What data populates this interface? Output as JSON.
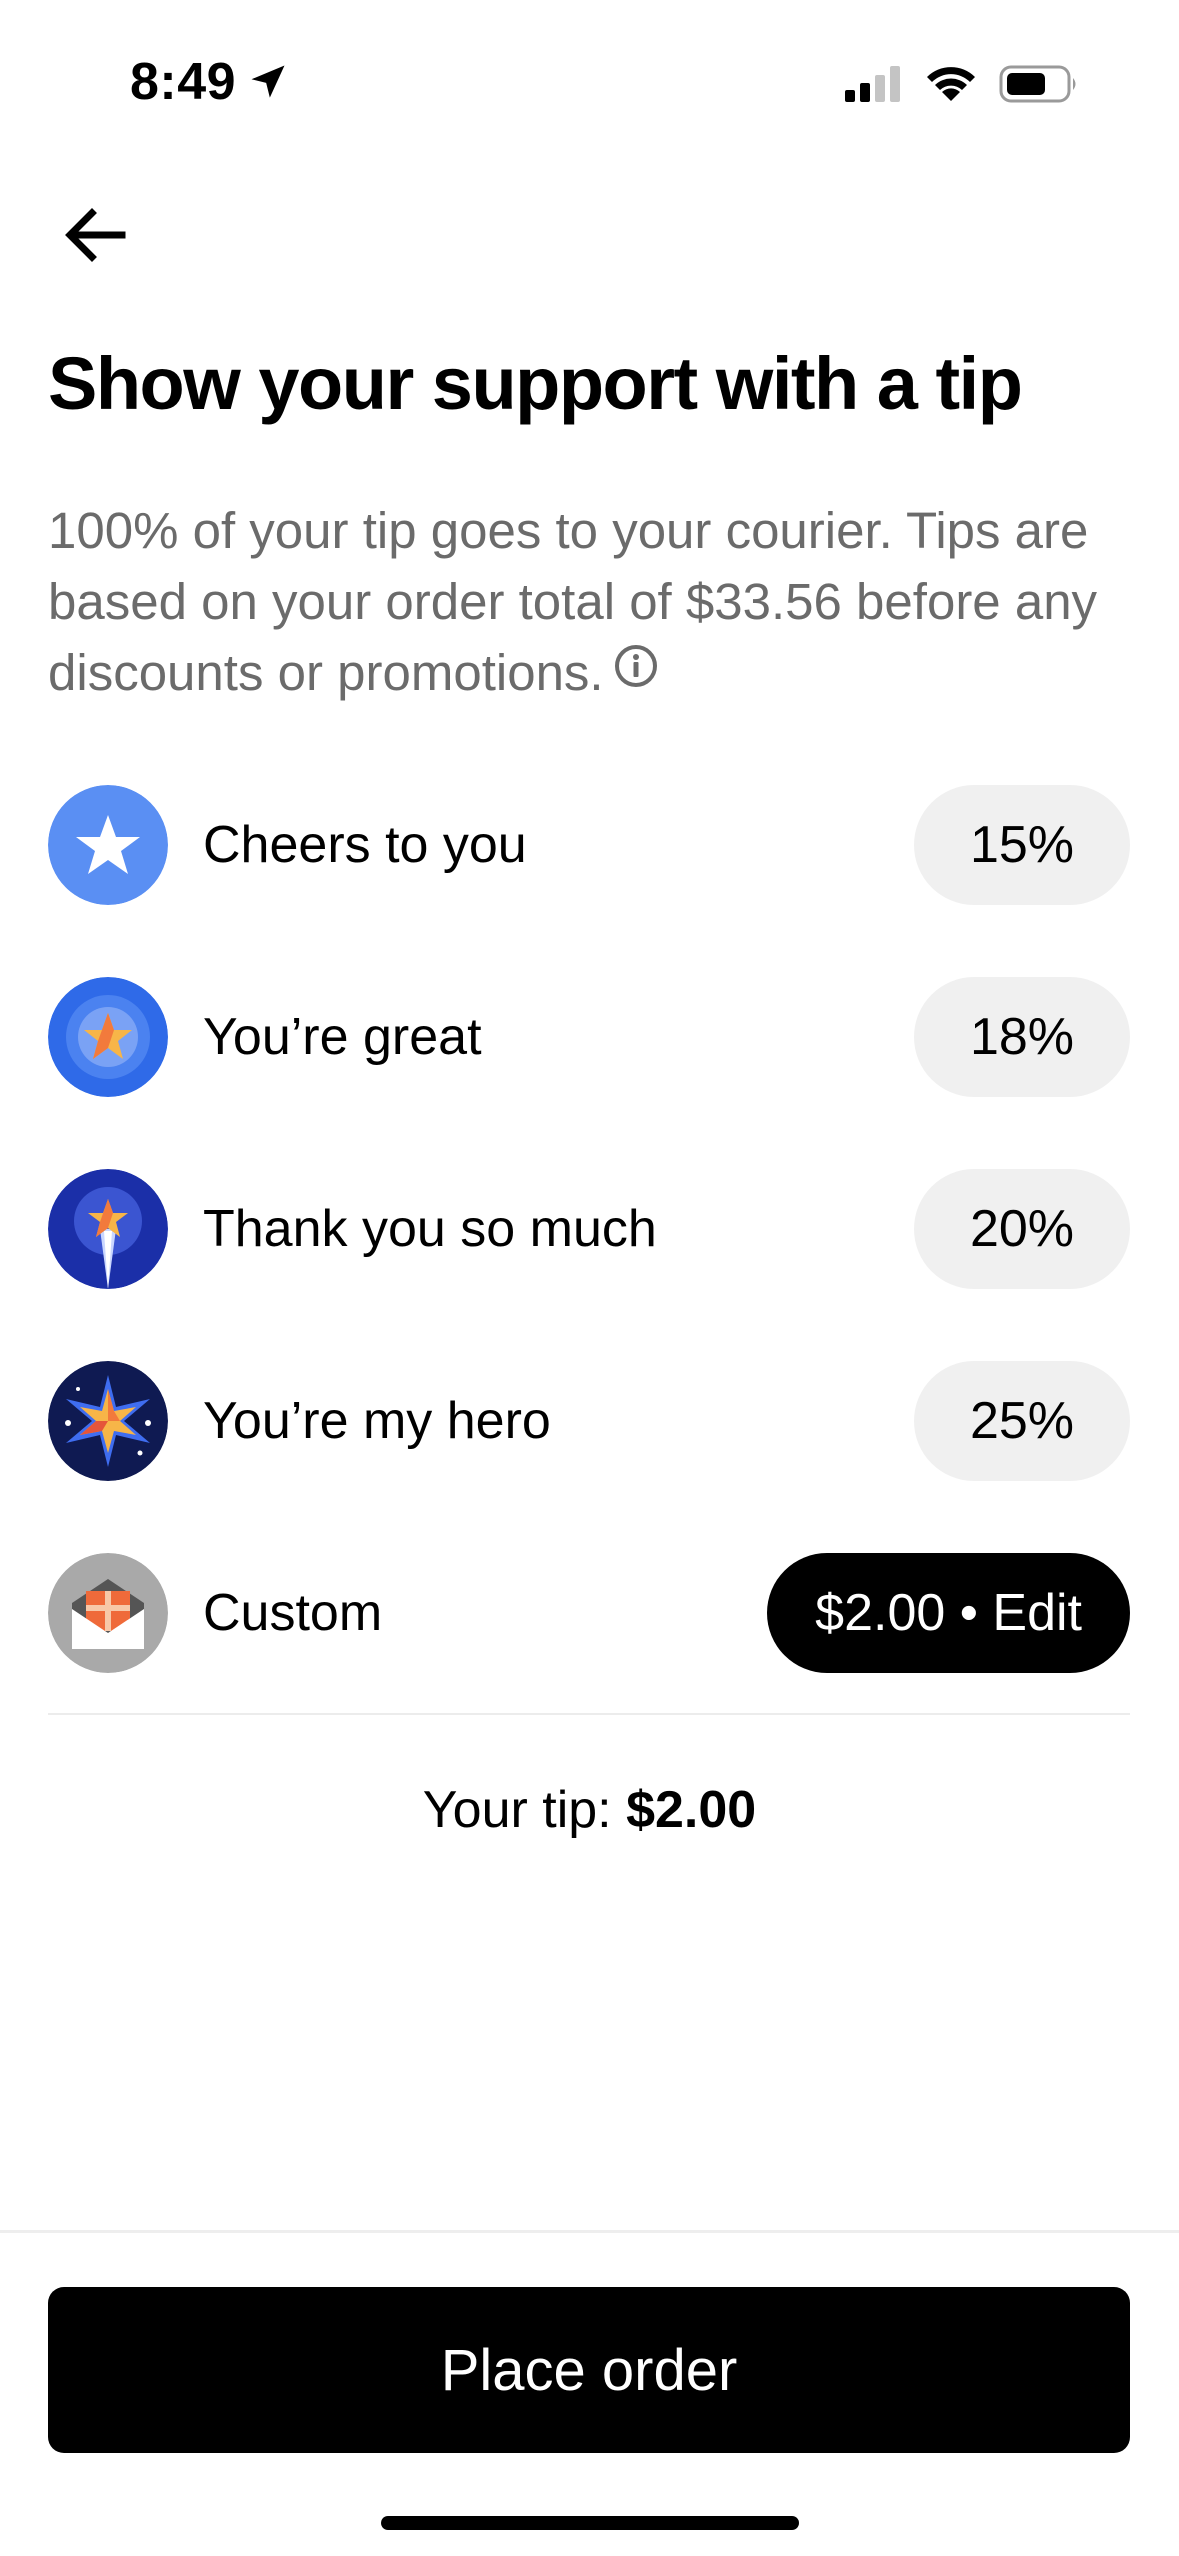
{
  "status_bar": {
    "time": "8:49"
  },
  "header": {
    "back_icon": "arrow-left-icon",
    "title": "Show your support with a tip",
    "subtitle": "100% of your tip goes to your courier. Tips are based on your order total of $33.56 before any discounts or promotions."
  },
  "tips": [
    {
      "label": "Cheers to you",
      "value": "15%",
      "icon": "star-badge-light-icon"
    },
    {
      "label": "You’re great",
      "value": "18%",
      "icon": "star-badge-blue-icon"
    },
    {
      "label": "Thank you so much",
      "value": "20%",
      "icon": "star-rocket-badge-icon"
    },
    {
      "label": "You’re my hero",
      "value": "25%",
      "icon": "hero-star-badge-icon"
    },
    {
      "label": "Custom",
      "value": "$2.00 • Edit",
      "icon": "gift-envelope-icon",
      "selected": true
    }
  ],
  "summary": {
    "label": "Your tip:",
    "amount": "$2.00"
  },
  "footer": {
    "button_label": "Place order"
  },
  "colors": {
    "accent": "#000000",
    "pill_bg": "#f0f0f0",
    "subtitle": "#6b6b6b"
  }
}
